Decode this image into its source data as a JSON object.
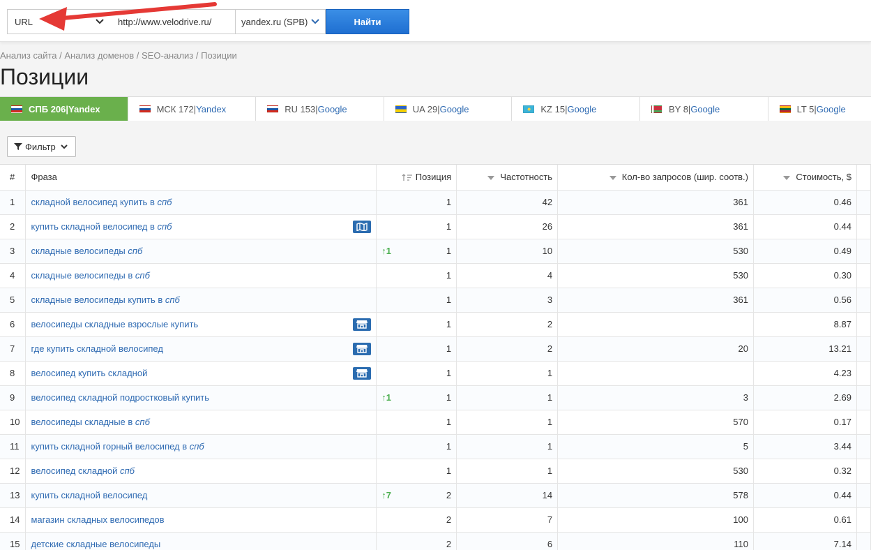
{
  "search": {
    "type_select": "URL",
    "url_value": "http://www.velodrive.ru/",
    "region_select": "yandex.ru (SPB)",
    "find_button": "Найти"
  },
  "breadcrumb": [
    "Анализ сайта",
    "Анализ доменов",
    "SEO-анализ",
    "Позиции"
  ],
  "breadcrumb_sep": " / ",
  "page_title": "Позиции",
  "tabs": [
    {
      "label": "СПБ 206",
      "engine": "Yandex",
      "flag": "ru-flag-icon",
      "active": true
    },
    {
      "label": "МСК 172",
      "engine": "Yandex",
      "flag": "ru-flag-icon"
    },
    {
      "label": "RU 153",
      "engine": "Google",
      "flag": "ru-flag-icon"
    },
    {
      "label": "UA 29",
      "engine": "Google",
      "flag": "ua-flag-icon"
    },
    {
      "label": "KZ 15",
      "engine": "Google",
      "flag": "kz-flag-icon"
    },
    {
      "label": "BY 8",
      "engine": "Google",
      "flag": "by-flag-icon"
    },
    {
      "label": "LT 5",
      "engine": "Google",
      "flag": "lt-flag-icon"
    }
  ],
  "tab_separator": " | ",
  "filter_button": "Фильтр",
  "table": {
    "headers": {
      "num": "#",
      "phrase": "Фраза",
      "position": "Позиция",
      "frequency": "Частотность",
      "requests": "Кол-во запросов (шир. соотв.)",
      "cost": "Стоимость, $"
    },
    "rows": [
      {
        "num": "1",
        "phrase": "складной велосипед купить в ",
        "phrase_em": "спб",
        "icon": "",
        "change": "",
        "position": "1",
        "frequency": "42",
        "requests": "361",
        "cost": "0.46"
      },
      {
        "num": "2",
        "phrase": "купить складной велосипед в ",
        "phrase_em": "спб",
        "icon": "map-icon",
        "change": "",
        "position": "1",
        "frequency": "26",
        "requests": "361",
        "cost": "0.44"
      },
      {
        "num": "3",
        "phrase": "складные велосипеды ",
        "phrase_em": "спб",
        "icon": "",
        "change": "1",
        "position": "1",
        "frequency": "10",
        "requests": "530",
        "cost": "0.49"
      },
      {
        "num": "4",
        "phrase": "складные велосипеды в ",
        "phrase_em": "спб",
        "icon": "",
        "change": "",
        "position": "1",
        "frequency": "4",
        "requests": "530",
        "cost": "0.30"
      },
      {
        "num": "5",
        "phrase": "складные велосипеды купить в ",
        "phrase_em": "спб",
        "icon": "",
        "change": "",
        "position": "1",
        "frequency": "3",
        "requests": "361",
        "cost": "0.56"
      },
      {
        "num": "6",
        "phrase": "велосипеды складные взрослые купить",
        "phrase_em": "",
        "icon": "store-icon",
        "change": "",
        "position": "1",
        "frequency": "2",
        "requests": "",
        "cost": "8.87"
      },
      {
        "num": "7",
        "phrase": "где купить складной велосипед",
        "phrase_em": "",
        "icon": "store-icon",
        "change": "",
        "position": "1",
        "frequency": "2",
        "requests": "20",
        "cost": "13.21"
      },
      {
        "num": "8",
        "phrase": "велосипед купить складной",
        "phrase_em": "",
        "icon": "store-icon",
        "change": "",
        "position": "1",
        "frequency": "1",
        "requests": "",
        "cost": "4.23"
      },
      {
        "num": "9",
        "phrase": "велосипед складной подростковый купить",
        "phrase_em": "",
        "icon": "",
        "change": "1",
        "position": "1",
        "frequency": "1",
        "requests": "3",
        "cost": "2.69"
      },
      {
        "num": "10",
        "phrase": "велосипеды складные в ",
        "phrase_em": "спб",
        "icon": "",
        "change": "",
        "position": "1",
        "frequency": "1",
        "requests": "570",
        "cost": "0.17"
      },
      {
        "num": "11",
        "phrase": "купить складной горный велосипед в ",
        "phrase_em": "спб",
        "icon": "",
        "change": "",
        "position": "1",
        "frequency": "1",
        "requests": "5",
        "cost": "3.44"
      },
      {
        "num": "12",
        "phrase": "велосипед складной ",
        "phrase_em": "спб",
        "icon": "",
        "change": "",
        "position": "1",
        "frequency": "1",
        "requests": "530",
        "cost": "0.32"
      },
      {
        "num": "13",
        "phrase": "купить складной велосипед",
        "phrase_em": "",
        "icon": "",
        "change": "7",
        "position": "2",
        "frequency": "14",
        "requests": "578",
        "cost": "0.44"
      },
      {
        "num": "14",
        "phrase": "магазин складных велосипедов",
        "phrase_em": "",
        "icon": "",
        "change": "",
        "position": "2",
        "frequency": "7",
        "requests": "100",
        "cost": "0.61"
      },
      {
        "num": "15",
        "phrase": "детские складные велосипеды",
        "phrase_em": "",
        "icon": "",
        "change": "",
        "position": "2",
        "frequency": "6",
        "requests": "110",
        "cost": "7.14"
      }
    ]
  },
  "colors": {
    "active_tab": "#6ab04c",
    "link": "#2e6ab2",
    "find_button": "#1f6fd1",
    "growth": "#4caf50",
    "annotation_arrow": "#e53935"
  }
}
